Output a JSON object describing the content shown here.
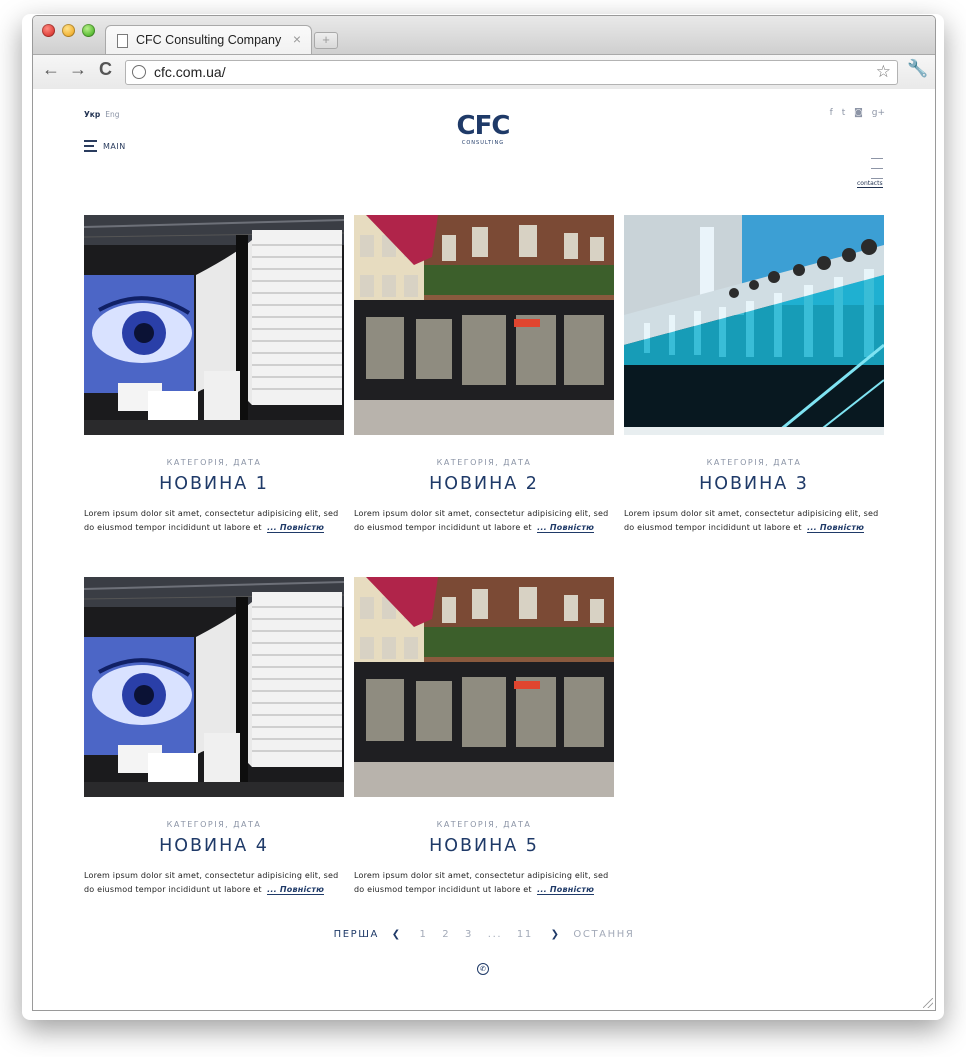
{
  "browser": {
    "tab_title": "CFC Consulting Company",
    "tab_close": "×",
    "new_tab": "+",
    "back": "←",
    "forward": "→",
    "reload": "C",
    "url": "cfc.com.ua/",
    "bookmark_star": "☆",
    "settings_glyph": "🔧"
  },
  "site": {
    "lang_active": "Укр",
    "lang_other": "Eng",
    "menu_label": "MAIN",
    "logo_main": "CFC",
    "logo_sub": "CONSULTING",
    "social": [
      "f",
      "t",
      "◙",
      "g+"
    ],
    "contacts_label": "contacts"
  },
  "posts": [
    {
      "category": "КАТЕГОРІЯ, ДАТА",
      "title": "НОВИНА 1",
      "text": "Lorem ipsum dolor sit amet, consectetur adipisicing elit, sed do eiusmod tempor incididunt ut labore et",
      "more": "... Повністю",
      "image": "eye-exhibition"
    },
    {
      "category": "КАТЕГОРІЯ, ДАТА",
      "title": "НОВИНА 2",
      "text": "Lorem ipsum dolor sit amet, consectetur adipisicing elit, sed do eiusmod tempor incididunt ut labore et",
      "more": "... Повністю",
      "image": "storefront"
    },
    {
      "category": "КАТЕГОРІЯ, ДАТА",
      "title": "НОВИНА 3",
      "text": "Lorem ipsum dolor sit amet, consectetur adipisicing elit, sed do eiusmod tempor incididunt ut labore et",
      "more": "... Повністю",
      "image": "glass-display"
    },
    {
      "category": "КАТЕГОРІЯ, ДАТА",
      "title": "НОВИНА 4",
      "text": "Lorem ipsum dolor sit amet, consectetur adipisicing elit, sed do eiusmod tempor incididunt ut labore et",
      "more": "... Повністю",
      "image": "eye-exhibition"
    },
    {
      "category": "КАТЕГОРІЯ, ДАТА",
      "title": "НОВИНА 5",
      "text": "Lorem ipsum dolor sit amet, consectetur adipisicing elit, sed do eiusmod tempor incididunt ut labore et",
      "more": "... Повністю",
      "image": "storefront"
    }
  ],
  "pagination": {
    "first": "ПЕРША",
    "prev": "❮",
    "pages": [
      "1",
      "2",
      "3",
      "...",
      "11"
    ],
    "next": "❯",
    "last": "ОСТАННЯ"
  },
  "footer": {
    "phone_icon": "✆"
  },
  "colors": {
    "accent": "#1f3a68",
    "muted": "#8b94a6"
  }
}
